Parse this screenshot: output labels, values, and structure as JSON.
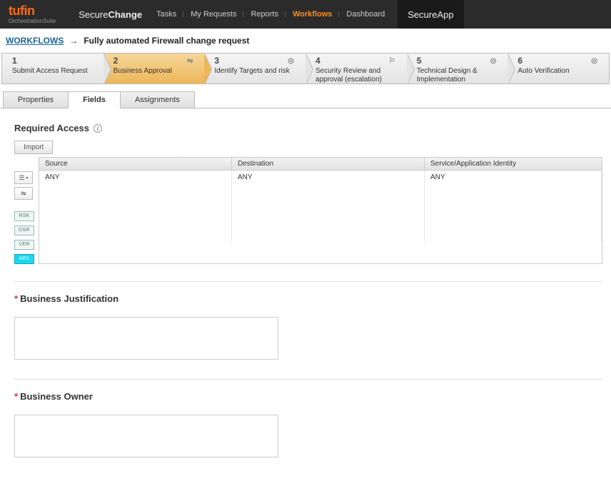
{
  "header": {
    "logo": "tufin",
    "logoSub": "OrchestrationSuite",
    "app1a": "Secure",
    "app1b": "Change",
    "navItems": [
      "Tasks",
      "My Requests",
      "Reports",
      "Workflows",
      "Dashboard"
    ],
    "navActive": 3,
    "app2a": "Secure",
    "app2b": "App"
  },
  "breadcrumb": {
    "root": "WORKFLOWS",
    "title": "Fully automated Firewall change request"
  },
  "steps": [
    {
      "n": "1",
      "label": "Submit Access Request"
    },
    {
      "n": "2",
      "label": "Business Approval"
    },
    {
      "n": "3",
      "label": "Identify Targets and risk"
    },
    {
      "n": "4",
      "label": "Security Review and approval (escalation)"
    },
    {
      "n": "5",
      "label": "Technical Design & Implementation"
    },
    {
      "n": "6",
      "label": "Auto Verification"
    }
  ],
  "activeStep": 1,
  "tabs": [
    "Properties",
    "Fields",
    "Assignments"
  ],
  "activeTab": 1,
  "requiredAccess": {
    "title": "Required Access",
    "importBtn": "Import",
    "columns": [
      "Source",
      "Destination",
      "Service/Application Identity"
    ],
    "row": [
      "ANY",
      "ANY",
      "ANY"
    ],
    "chips": [
      "RSK",
      "DSR",
      "VER",
      "AR1"
    ]
  },
  "sections": {
    "bj": "Business Justification",
    "bo": "Business Owner"
  }
}
